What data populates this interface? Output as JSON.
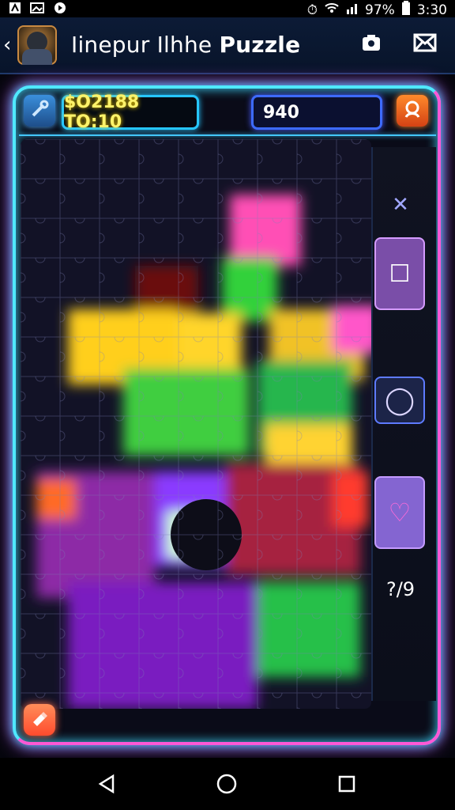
{
  "status": {
    "battery": "97%",
    "time": "3:30"
  },
  "appbar": {
    "title_part1": "Iinepur",
    "title_part2": "Ilhhe",
    "title_part3": "Puzzle"
  },
  "hud": {
    "timer": "$O2188 TO:10",
    "score": "940"
  },
  "tray": {
    "items": [
      {
        "glyph": "✕"
      },
      {
        "glyph": "☐"
      },
      {
        "glyph": "◯"
      },
      {
        "glyph": "♡"
      },
      {
        "glyph": "?/9"
      }
    ]
  },
  "colors": {
    "frame": "#4fe9ff",
    "accent": "#ff58d6",
    "timer_text": "#fff36a"
  },
  "icons": [
    "back-icon",
    "camera-icon",
    "envelope-icon",
    "wrench-icon",
    "profile-icon",
    "eraser-icon"
  ]
}
